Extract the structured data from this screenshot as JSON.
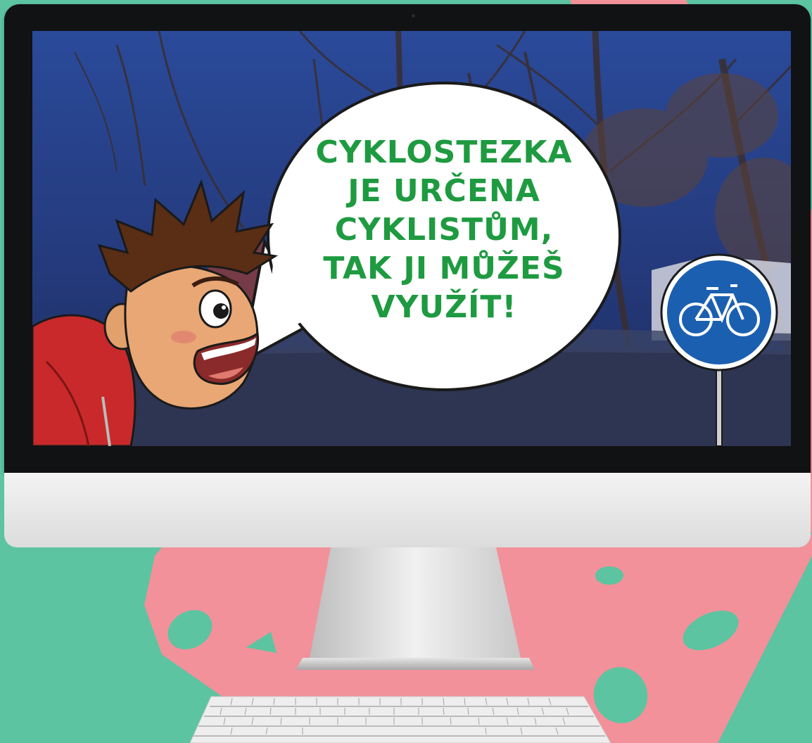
{
  "speech_bubble": {
    "lines": [
      "CYKLOSTEZKA",
      "JE URČENA",
      "CYKLISTŮM,",
      "TAK JI MŮŽEŠ",
      "VYUŽÍT!"
    ]
  },
  "colors": {
    "background": "#5cc4a0",
    "blob": "#f2919a",
    "text_green": "#1e9a40",
    "sign_blue": "#1b5fb0",
    "jacket_red": "#c9292a"
  },
  "icons": {
    "sign": "bicycle-icon"
  }
}
